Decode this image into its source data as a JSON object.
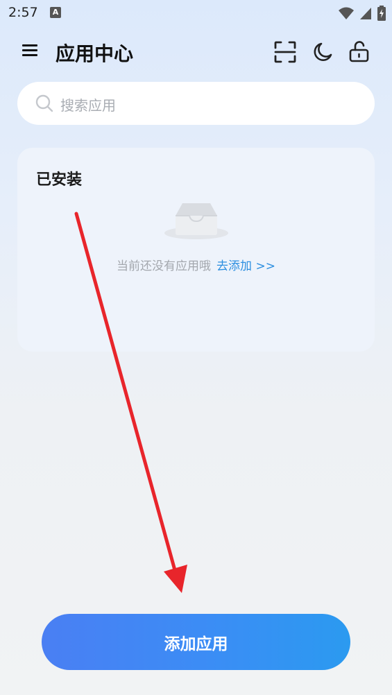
{
  "status_bar": {
    "time": "2:57",
    "notification_badge": "A",
    "icons": [
      "wifi-icon",
      "signal-icon",
      "battery-charging-icon"
    ]
  },
  "header": {
    "title": "应用中心",
    "icons": [
      "menu-icon",
      "scan-icon",
      "moon-icon",
      "unlock-icon"
    ]
  },
  "search": {
    "placeholder": "搜索应用"
  },
  "installed": {
    "title": "已安装",
    "empty_text": "当前还没有应用哦",
    "add_link": "去添加 >>"
  },
  "footer": {
    "add_button": "添加应用"
  },
  "colors": {
    "accent_blue": "#3b8df5",
    "link_blue": "#2d8fe0",
    "annotation_arrow": "#e8252b"
  }
}
